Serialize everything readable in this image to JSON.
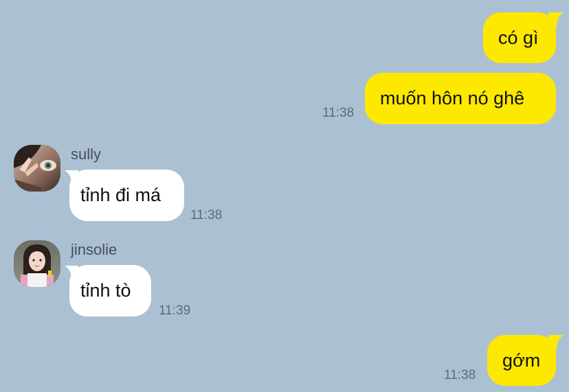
{
  "chat": {
    "messages": [
      {
        "direction": "out",
        "text": "có gì"
      },
      {
        "direction": "out",
        "text": "muốn hôn nó ghê",
        "time": "11:38"
      },
      {
        "direction": "in",
        "sender": "sully",
        "avatar_icon": "user-avatar-icon",
        "text": "tỉnh đi má",
        "time": "11:38"
      },
      {
        "direction": "in",
        "sender": "jinsolie",
        "avatar_icon": "user-avatar-icon",
        "text": "tỉnh tò",
        "time": "11:39"
      },
      {
        "direction": "out",
        "text": "gớm",
        "time": "11:38"
      }
    ]
  },
  "colors": {
    "background": "#abc1d3",
    "outgoing_bubble": "#fde800",
    "incoming_bubble": "#ffffff",
    "timestamp": "#5e6a74",
    "sender_name": "#474f56"
  }
}
